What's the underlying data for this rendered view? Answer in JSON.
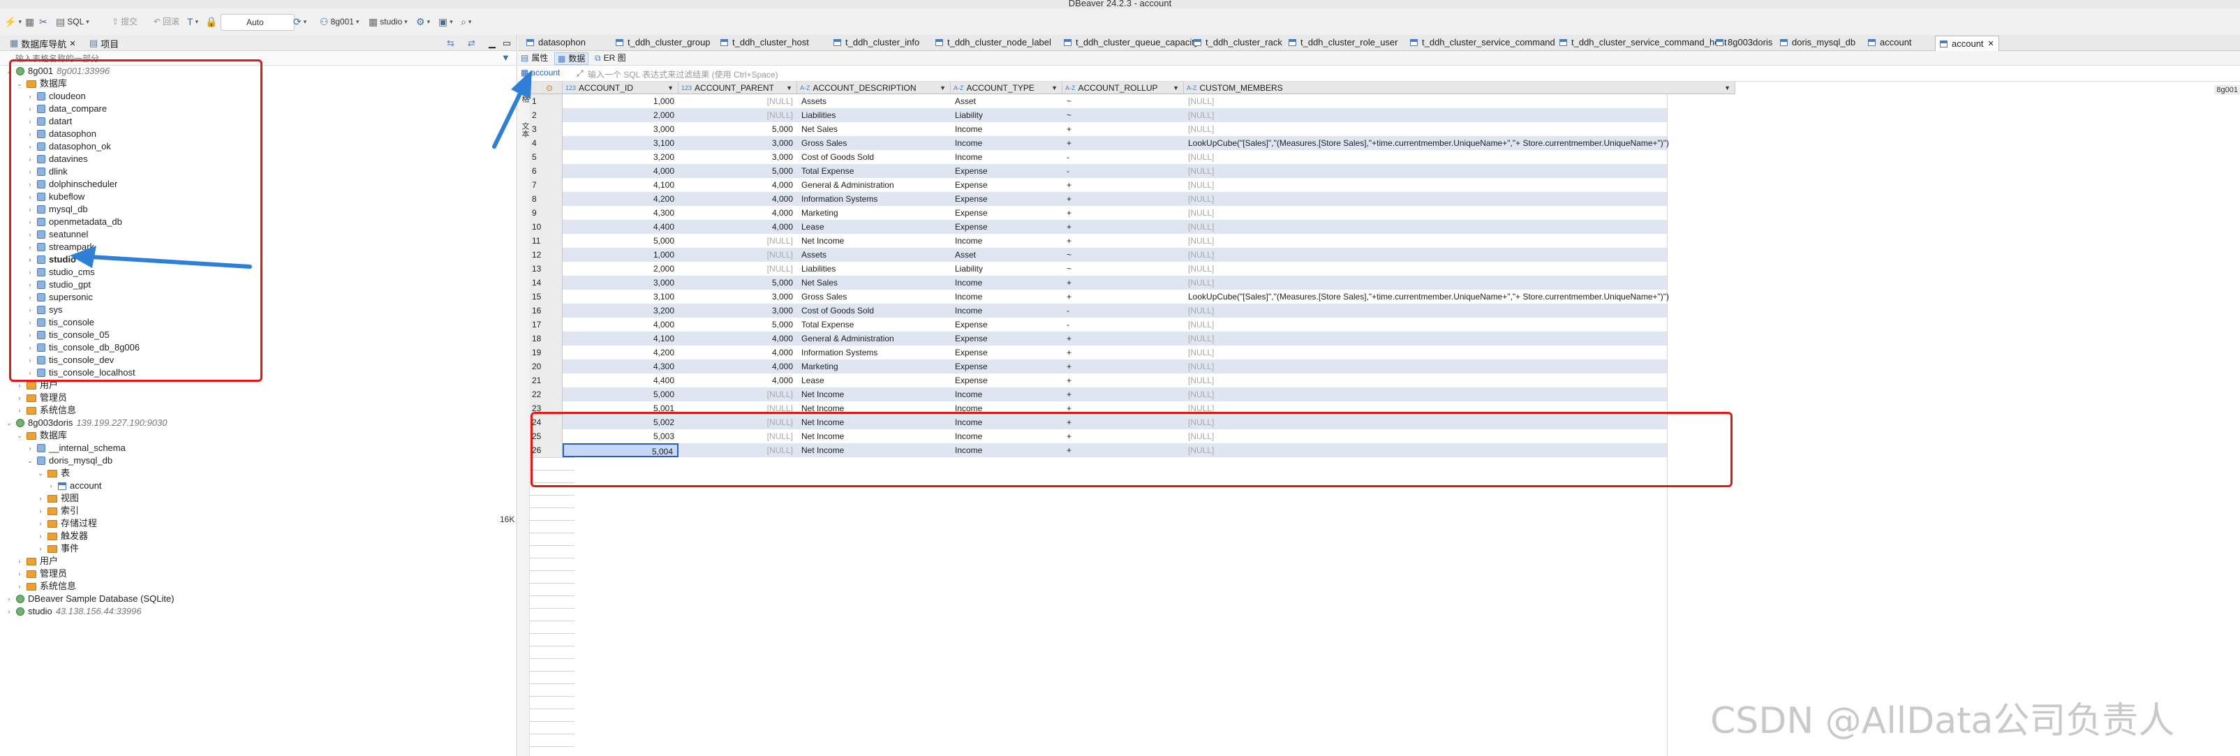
{
  "window": {
    "title": "DBeaver 24.2.3 - account"
  },
  "toolbar": {
    "sql": "SQL",
    "commit": "提交",
    "rollback": "回滚",
    "tx_mode": "Auto",
    "connection": "8g001",
    "schema": "studio"
  },
  "navigator": {
    "tab_db": "数据库导航",
    "tab_projects": "项目",
    "filter_placeholder": "输入表格名称的一部分",
    "tree": [
      {
        "label": "8g001",
        "addr": "8g001:33996",
        "indent": 0,
        "type": "conn",
        "open": true
      },
      {
        "label": "数据库",
        "indent": 1,
        "type": "folder",
        "open": true
      },
      {
        "label": "cloudeon",
        "indent": 2,
        "type": "db"
      },
      {
        "label": "data_compare",
        "indent": 2,
        "type": "db"
      },
      {
        "label": "datart",
        "indent": 2,
        "type": "db"
      },
      {
        "label": "datasophon",
        "indent": 2,
        "type": "db"
      },
      {
        "label": "datasophon_ok",
        "indent": 2,
        "type": "db"
      },
      {
        "label": "datavines",
        "indent": 2,
        "type": "db"
      },
      {
        "label": "dlink",
        "indent": 2,
        "type": "db"
      },
      {
        "label": "dolphinscheduler",
        "indent": 2,
        "type": "db"
      },
      {
        "label": "kubeflow",
        "indent": 2,
        "type": "db"
      },
      {
        "label": "mysql_db",
        "indent": 2,
        "type": "db"
      },
      {
        "label": "openmetadata_db",
        "indent": 2,
        "type": "db"
      },
      {
        "label": "seatunnel",
        "indent": 2,
        "type": "db"
      },
      {
        "label": "streampark",
        "indent": 2,
        "type": "db"
      },
      {
        "label": "studio",
        "indent": 2,
        "type": "db",
        "bold": true
      },
      {
        "label": "studio_cms",
        "indent": 2,
        "type": "db"
      },
      {
        "label": "studio_gpt",
        "indent": 2,
        "type": "db"
      },
      {
        "label": "supersonic",
        "indent": 2,
        "type": "db"
      },
      {
        "label": "sys",
        "indent": 2,
        "type": "db"
      },
      {
        "label": "tis_console",
        "indent": 2,
        "type": "db"
      },
      {
        "label": "tis_console_05",
        "indent": 2,
        "type": "db"
      },
      {
        "label": "tis_console_db_8g006",
        "indent": 2,
        "type": "db"
      },
      {
        "label": "tis_console_dev",
        "indent": 2,
        "type": "db"
      },
      {
        "label": "tis_console_localhost",
        "indent": 2,
        "type": "db"
      },
      {
        "label": "用户",
        "indent": 1,
        "type": "folder"
      },
      {
        "label": "管理员",
        "indent": 1,
        "type": "folder"
      },
      {
        "label": "系统信息",
        "indent": 1,
        "type": "folder"
      },
      {
        "label": "8g003doris",
        "addr": "139.199.227.190:9030",
        "indent": 0,
        "type": "conn",
        "open": true
      },
      {
        "label": "数据库",
        "indent": 1,
        "type": "folder",
        "open": true
      },
      {
        "label": "__internal_schema",
        "indent": 2,
        "type": "db"
      },
      {
        "label": "doris_mysql_db",
        "indent": 2,
        "type": "db",
        "open": true
      },
      {
        "label": "表",
        "indent": 3,
        "type": "folder",
        "open": true
      },
      {
        "label": "account",
        "indent": 4,
        "type": "table"
      },
      {
        "label": "视图",
        "indent": 3,
        "type": "folder"
      },
      {
        "label": "索引",
        "indent": 3,
        "type": "folder"
      },
      {
        "label": "存储过程",
        "indent": 3,
        "type": "folder"
      },
      {
        "label": "触发器",
        "indent": 3,
        "type": "folder"
      },
      {
        "label": "事件",
        "indent": 3,
        "type": "folder"
      },
      {
        "label": "用户",
        "indent": 1,
        "type": "folder"
      },
      {
        "label": "管理员",
        "indent": 1,
        "type": "folder"
      },
      {
        "label": "系统信息",
        "indent": 1,
        "type": "folder"
      },
      {
        "label": "DBeaver Sample Database (SQLite)",
        "indent": 0,
        "type": "conn"
      },
      {
        "label": "studio",
        "addr": "43.138.156.44:33996",
        "indent": 0,
        "type": "conn"
      }
    ],
    "size_label": "16K"
  },
  "editor": {
    "tabs": [
      "datasophon",
      "t_ddh_cluster_group",
      "t_ddh_cluster_host",
      "t_ddh_cluster_info",
      "t_ddh_cluster_node_label",
      "t_ddh_cluster_queue_capacity",
      "t_ddh_cluster_rack",
      "t_ddh_cluster_role_user",
      "t_ddh_cluster_service_command",
      "t_ddh_cluster_service_command_host",
      "8g003doris",
      "doris_mysql_db",
      "account",
      "account"
    ],
    "active_tab": 13,
    "subtabs": [
      "属性",
      "数据",
      "ER 图"
    ],
    "active_subtab": 1,
    "filter_table": "account",
    "filter_hint": "输入一个 SQL 表达式来过滤结果 (使用 Ctrl+Space)",
    "side_labels": [
      "网格",
      "文本"
    ],
    "corner_tag": "8g001",
    "columns": [
      {
        "type": "123",
        "name": "ACCOUNT_ID"
      },
      {
        "type": "123",
        "name": "ACCOUNT_PARENT"
      },
      {
        "type": "A-Z",
        "name": "ACCOUNT_DESCRIPTION"
      },
      {
        "type": "A-Z",
        "name": "ACCOUNT_TYPE"
      },
      {
        "type": "A-Z",
        "name": "ACCOUNT_ROLLUP"
      },
      {
        "type": "A-Z",
        "name": "CUSTOM_MEMBERS"
      }
    ],
    "rows": [
      [
        "1,000",
        "[NULL]",
        "Assets",
        "Asset",
        "~",
        "[NULL]"
      ],
      [
        "2,000",
        "[NULL]",
        "Liabilities",
        "Liability",
        "~",
        "[NULL]"
      ],
      [
        "3,000",
        "5,000",
        "Net Sales",
        "Income",
        "+",
        "[NULL]"
      ],
      [
        "3,100",
        "3,000",
        "Gross Sales",
        "Income",
        "+",
        "LookUpCube(\"[Sales]\",\"(Measures.[Store Sales],\"+time.currentmember.UniqueName+\",\"+ Store.currentmember.UniqueName+\")\")"
      ],
      [
        "3,200",
        "3,000",
        "Cost of Goods Sold",
        "Income",
        "-",
        "[NULL]"
      ],
      [
        "4,000",
        "5,000",
        "Total Expense",
        "Expense",
        "-",
        "[NULL]"
      ],
      [
        "4,100",
        "4,000",
        "General & Administration",
        "Expense",
        "+",
        "[NULL]"
      ],
      [
        "4,200",
        "4,000",
        "Information Systems",
        "Expense",
        "+",
        "[NULL]"
      ],
      [
        "4,300",
        "4,000",
        "Marketing",
        "Expense",
        "+",
        "[NULL]"
      ],
      [
        "4,400",
        "4,000",
        "Lease",
        "Expense",
        "+",
        "[NULL]"
      ],
      [
        "5,000",
        "[NULL]",
        "Net Income",
        "Income",
        "+",
        "[NULL]"
      ],
      [
        "1,000",
        "[NULL]",
        "Assets",
        "Asset",
        "~",
        "[NULL]"
      ],
      [
        "2,000",
        "[NULL]",
        "Liabilities",
        "Liability",
        "~",
        "[NULL]"
      ],
      [
        "3,000",
        "5,000",
        "Net Sales",
        "Income",
        "+",
        "[NULL]"
      ],
      [
        "3,100",
        "3,000",
        "Gross Sales",
        "Income",
        "+",
        "LookUpCube(\"[Sales]\",\"(Measures.[Store Sales],\"+time.currentmember.UniqueName+\",\"+ Store.currentmember.UniqueName+\")\")"
      ],
      [
        "3,200",
        "3,000",
        "Cost of Goods Sold",
        "Income",
        "-",
        "[NULL]"
      ],
      [
        "4,000",
        "5,000",
        "Total Expense",
        "Expense",
        "-",
        "[NULL]"
      ],
      [
        "4,100",
        "4,000",
        "General & Administration",
        "Expense",
        "+",
        "[NULL]"
      ],
      [
        "4,200",
        "4,000",
        "Information Systems",
        "Expense",
        "+",
        "[NULL]"
      ],
      [
        "4,300",
        "4,000",
        "Marketing",
        "Expense",
        "+",
        "[NULL]"
      ],
      [
        "4,400",
        "4,000",
        "Lease",
        "Expense",
        "+",
        "[NULL]"
      ],
      [
        "5,000",
        "[NULL]",
        "Net Income",
        "Income",
        "+",
        "[NULL]"
      ],
      [
        "5,001",
        "[NULL]",
        "Net Income",
        "Income",
        "+",
        "[NULL]"
      ],
      [
        "5,002",
        "[NULL]",
        "Net Income",
        "Income",
        "+",
        "[NULL]"
      ],
      [
        "5,003",
        "[NULL]",
        "Net Income",
        "Income",
        "+",
        "[NULL]"
      ],
      [
        "5,004",
        "[NULL]",
        "Net Income",
        "Income",
        "+",
        "[NULL]"
      ]
    ]
  },
  "watermark": "CSDN @AllData公司负责人",
  "colors": {
    "highlight": "#e01818",
    "arrow": "#2f7fd8",
    "row_alt": "#dfe6f2",
    "selection": "#2c5fb3"
  }
}
